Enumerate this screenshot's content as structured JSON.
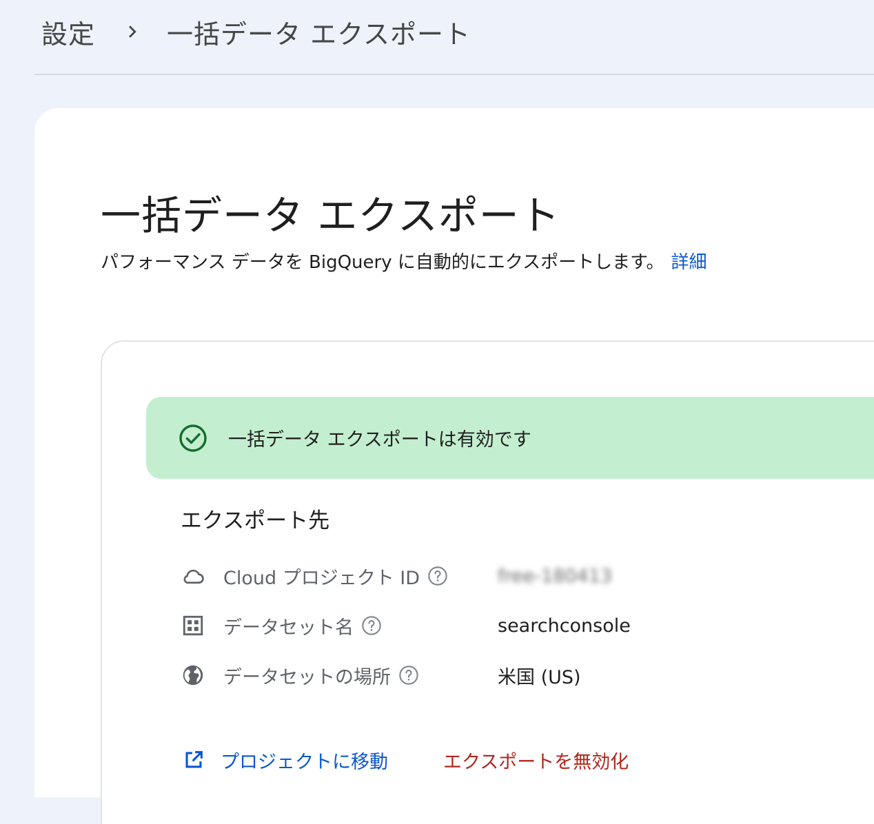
{
  "breadcrumb": {
    "parent": "設定",
    "current": "一括データ エクスポート"
  },
  "page": {
    "title": "一括データ エクスポート",
    "subtitle": "パフォーマンス データを BigQuery に自動的にエクスポートします。",
    "learn_more": "詳細"
  },
  "status": {
    "text": "一括データ エクスポートは有効です",
    "icon": "check-circle-icon",
    "color": "#c4eed0"
  },
  "destination": {
    "title": "エクスポート先",
    "rows": [
      {
        "icon": "cloud-icon",
        "label": "Cloud プロジェクト ID",
        "value": "free-180413",
        "obscured": true
      },
      {
        "icon": "dataset-grid-icon",
        "label": "データセット名",
        "value": "searchconsole"
      },
      {
        "icon": "globe-icon",
        "label": "データセットの場所",
        "value": "米国 (US)"
      }
    ]
  },
  "actions": {
    "go_to_project": "プロジェクトに移動",
    "disable_export": "エクスポートを無効化"
  },
  "colors": {
    "link": "#0b57d0",
    "danger": "#b3261e",
    "success": "#146c2e",
    "background": "#eef2fa"
  }
}
